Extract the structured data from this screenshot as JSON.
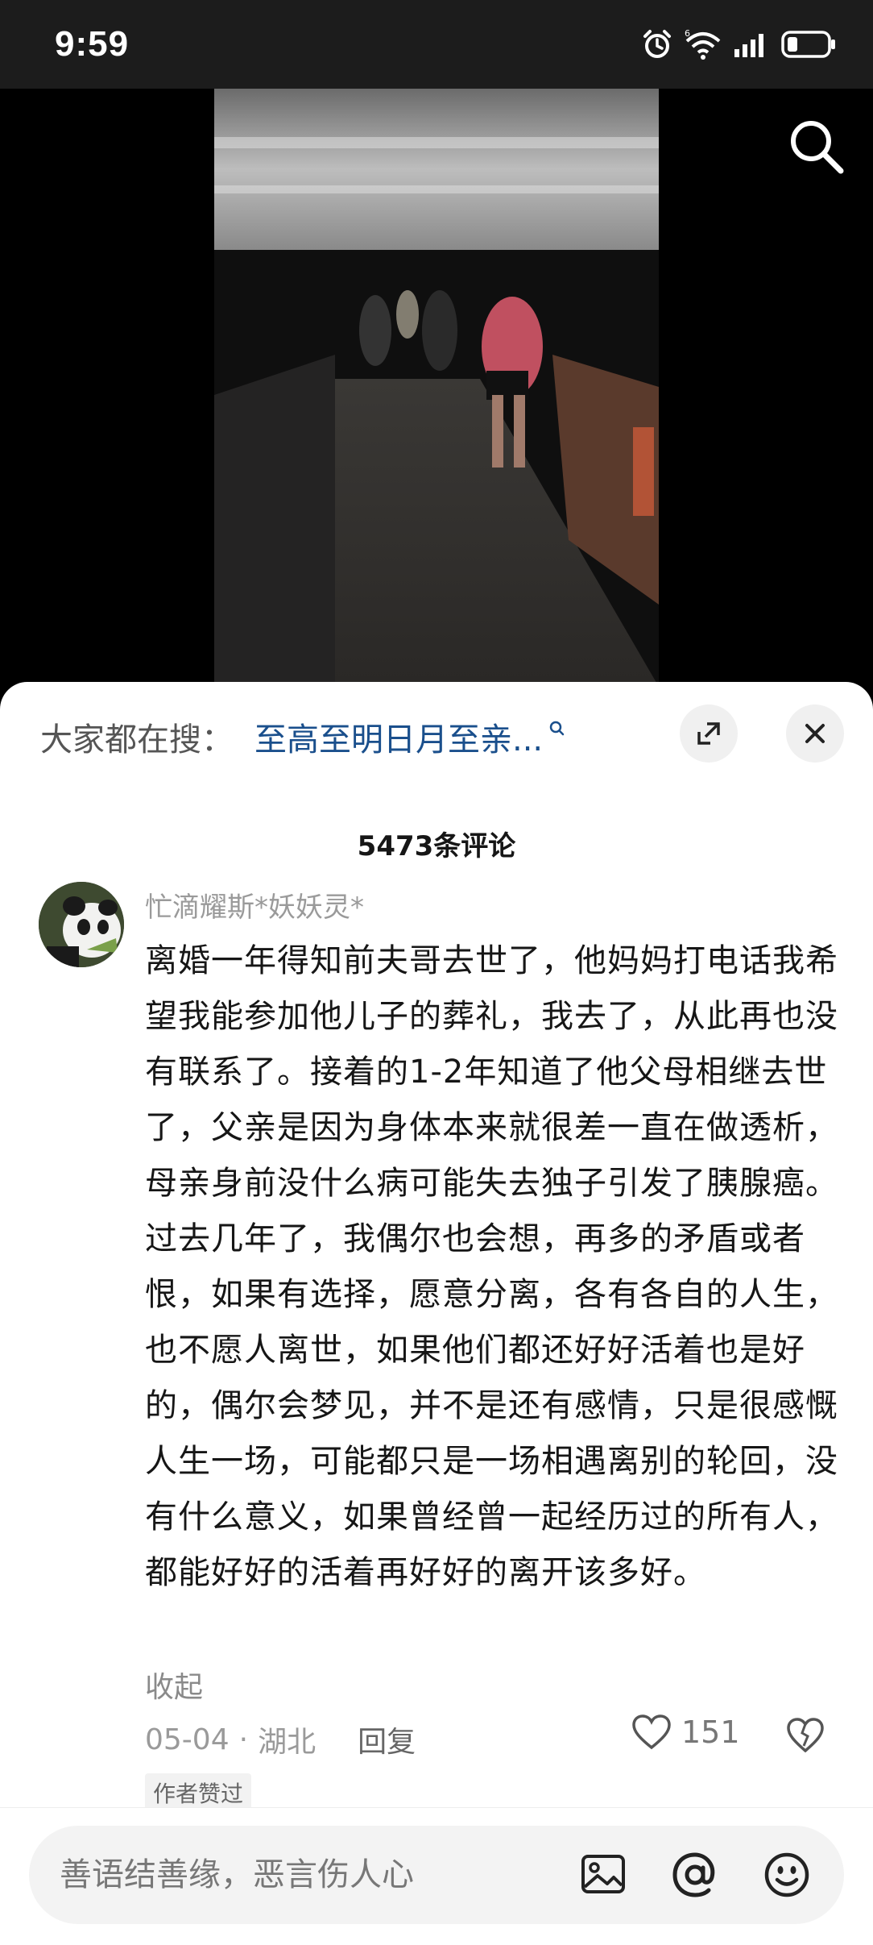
{
  "status_bar": {
    "time": "9:59",
    "battery_level": 0.25
  },
  "hot_search": {
    "label": "大家都在搜：",
    "query": "至高至明日月至亲..."
  },
  "comments": {
    "count_label": "5473条评论",
    "item": {
      "username": "忙滴耀斯*妖妖灵*",
      "text": "离婚一年得知前夫哥去世了，他妈妈打电话我希望我能参加他儿子的葬礼，我去了，从此再也没有联系了。接着的1-2年知道了他父母相继去世了，父亲是因为身体本来就很差一直在做透析，母亲身前没什么病可能失去独子引发了胰腺癌。过去几年了，我偶尔也会想，再多的矛盾或者恨，如果有选择，愿意分离，各有各自的人生，也不愿人离世，如果他们都还好好活着也是好的，偶尔会梦见，并不是还有感情，只是很感慨人生一场，可能都只是一场相遇离别的轮回，没有什么意义，如果曾经曾一起经历过的所有人，都能好好的活着再好好的离开该多好。",
      "collapse_label": "收起",
      "date": "05-04",
      "separator": "·",
      "location": "湖北",
      "reply_label": "回复",
      "likes": "151",
      "author_badge": "作者赞过"
    }
  },
  "input": {
    "placeholder": "善语结善缘，恶言伤人心"
  },
  "colors": {
    "accent_link": "#1a4f8c",
    "status_bar_bg": "#1c1c1c"
  },
  "icons": [
    "alarm-icon",
    "wifi-icon",
    "signal-icon",
    "battery-icon",
    "search-icon",
    "search-small-icon",
    "expand-icon",
    "close-icon",
    "heart-icon",
    "dislike-icon",
    "image-icon",
    "at-icon",
    "emoji-icon"
  ]
}
